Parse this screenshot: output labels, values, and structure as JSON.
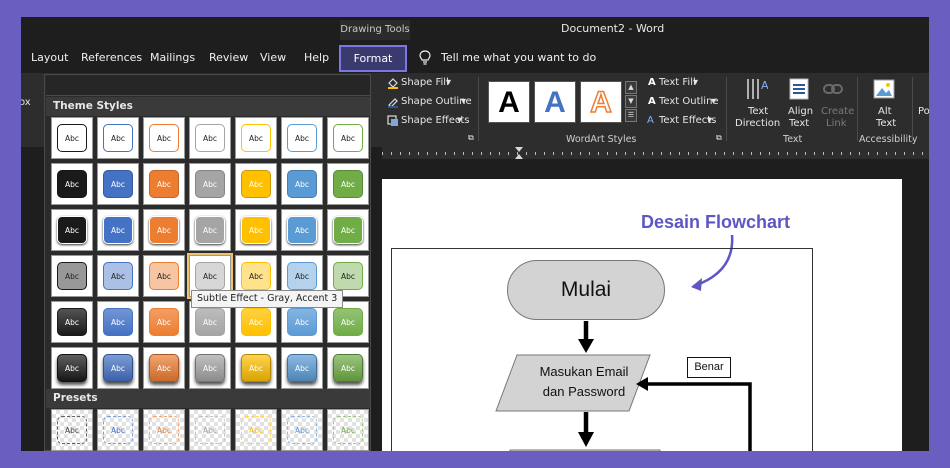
{
  "titlebar": {
    "context_label": "Drawing Tools",
    "doc_title": "Document2  -  Word"
  },
  "tabs": {
    "items": [
      "Layout",
      "References",
      "Mailings",
      "Review",
      "View",
      "Help"
    ],
    "active": "Format",
    "tell_me": "Tell me what you want to do"
  },
  "ribbon": {
    "fragment": "ox",
    "shape_styles": {
      "fill": "Shape Fill",
      "outline": "Shape Outline",
      "effects": "Shape Effects"
    },
    "wordart": {
      "label": "WordArt Styles",
      "preview_letter": "A",
      "text_fill": "Text Fill",
      "text_outline": "Text Outline",
      "text_effects": "Text Effects"
    },
    "text_group": {
      "label": "Text",
      "direction_1": "Text",
      "direction_2": "Direction",
      "align_1": "Align",
      "align_2": "Text",
      "link_1": "Create",
      "link_2": "Link"
    },
    "accessibility": {
      "label": "Accessibility",
      "alt_1": "Alt",
      "alt_2": "Text",
      "cut": "Po"
    }
  },
  "gallery": {
    "theme_styles_header": "Theme Styles",
    "presets_header": "Presets",
    "tile_text": "Abc",
    "accent_colors": [
      "#1a1a1a",
      "#4472c4",
      "#ed7d31",
      "#a5a5a5",
      "#ffc000",
      "#5b9bd5",
      "#70ad47"
    ],
    "tooltip": "Subtle Effect - Gray, Accent 3"
  },
  "document": {
    "annotation": "Desain Flowchart",
    "start_label": "Mulai",
    "input_line1": "Masukan Email",
    "input_line2": "dan Password",
    "yes_label": "Benar"
  }
}
